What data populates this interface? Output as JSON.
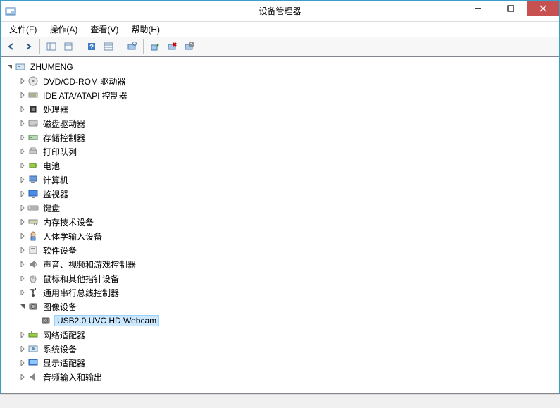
{
  "window": {
    "title": "设备管理器"
  },
  "menu": {
    "file": "文件(F)",
    "action": "操作(A)",
    "view": "查看(V)",
    "help": "帮助(H)"
  },
  "tree": {
    "root": "ZHUMENG",
    "nodes": [
      {
        "label": "DVD/CD-ROM 驱动器",
        "icon": "disc"
      },
      {
        "label": "IDE ATA/ATAPI 控制器",
        "icon": "ide"
      },
      {
        "label": "处理器",
        "icon": "cpu"
      },
      {
        "label": "磁盘驱动器",
        "icon": "disk"
      },
      {
        "label": "存储控制器",
        "icon": "storage"
      },
      {
        "label": "打印队列",
        "icon": "printer"
      },
      {
        "label": "电池",
        "icon": "battery"
      },
      {
        "label": "计算机",
        "icon": "computer"
      },
      {
        "label": "监视器",
        "icon": "monitor"
      },
      {
        "label": "键盘",
        "icon": "keyboard"
      },
      {
        "label": "内存技术设备",
        "icon": "memory"
      },
      {
        "label": "人体学输入设备",
        "icon": "hid"
      },
      {
        "label": "软件设备",
        "icon": "software"
      },
      {
        "label": "声音、视频和游戏控制器",
        "icon": "sound"
      },
      {
        "label": "鼠标和其他指针设备",
        "icon": "mouse"
      },
      {
        "label": "通用串行总线控制器",
        "icon": "usb"
      },
      {
        "label": "图像设备",
        "icon": "image",
        "expanded": true,
        "children": [
          {
            "label": "USB2.0 UVC HD Webcam",
            "icon": "webcam",
            "selected": true
          }
        ]
      },
      {
        "label": "网络适配器",
        "icon": "network"
      },
      {
        "label": "系统设备",
        "icon": "system"
      },
      {
        "label": "显示适配器",
        "icon": "display"
      },
      {
        "label": "音频输入和输出",
        "icon": "audio"
      }
    ]
  }
}
